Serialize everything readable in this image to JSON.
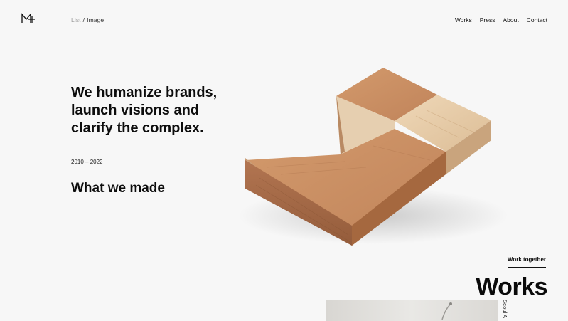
{
  "breadcrumb": {
    "list": "List",
    "separator": "/",
    "current": "Image"
  },
  "nav": {
    "items": [
      {
        "label": "Works",
        "active": true
      },
      {
        "label": "Press",
        "active": false
      },
      {
        "label": "About",
        "active": false
      },
      {
        "label": "Contact",
        "active": false
      }
    ]
  },
  "hero": {
    "headline": [
      "We humanize brands,",
      "launch visions and",
      "clarify the complex."
    ],
    "years": "2010 – 2022",
    "section_title": "What we made"
  },
  "works": {
    "cta": "Work together",
    "title": "Works",
    "caption": "Seoul A"
  },
  "colors": {
    "background": "#f7f7f7",
    "text": "#111111",
    "wood_light": "#e4c9a6",
    "wood_mid": "#c58a5c",
    "wood_dark": "#a86b44"
  }
}
